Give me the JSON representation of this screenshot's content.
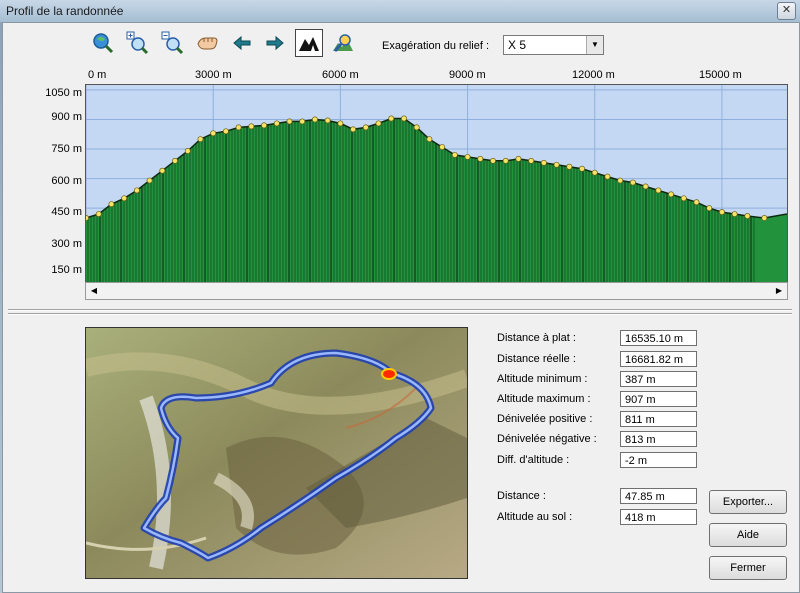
{
  "window": {
    "title": "Profil de la randonnée",
    "close": "✕"
  },
  "toolbar": {
    "exaggeration_label": "Exagération du relief :",
    "exaggeration_value": "X 5",
    "tools": [
      "zoom-all-icon",
      "zoom-in-icon",
      "zoom-out-icon",
      "pan-hand-icon",
      "back-arrow-icon",
      "forward-arrow-icon",
      "terrain-view-icon",
      "profile-zoom-icon"
    ]
  },
  "chart_data": {
    "type": "area",
    "x_ticks": [
      "0 m",
      "3000 m",
      "6000 m",
      "9000 m",
      "12000 m",
      "15000 m"
    ],
    "y_ticks": [
      "1050 m",
      "900 m",
      "750 m",
      "600 m",
      "450 m",
      "300 m",
      "150 m"
    ],
    "xlim": [
      0,
      16535
    ],
    "ylim": [
      75,
      1075
    ],
    "x": [
      0,
      300,
      600,
      900,
      1200,
      1500,
      1800,
      2100,
      2400,
      2700,
      3000,
      3300,
      3600,
      3900,
      4200,
      4500,
      4800,
      5100,
      5400,
      5700,
      6000,
      6300,
      6600,
      6900,
      7200,
      7500,
      7800,
      8100,
      8400,
      8700,
      9000,
      9300,
      9600,
      9900,
      10200,
      10500,
      10800,
      11100,
      11400,
      11700,
      12000,
      12300,
      12600,
      12900,
      13200,
      13500,
      13800,
      14100,
      14400,
      14700,
      15000,
      15300,
      15600,
      16000,
      16535
    ],
    "y": [
      400,
      420,
      470,
      500,
      540,
      590,
      640,
      690,
      740,
      800,
      830,
      840,
      860,
      865,
      870,
      880,
      890,
      890,
      900,
      895,
      880,
      850,
      860,
      880,
      905,
      905,
      860,
      800,
      760,
      720,
      710,
      700,
      690,
      690,
      700,
      690,
      680,
      670,
      660,
      650,
      630,
      610,
      590,
      580,
      560,
      540,
      520,
      500,
      480,
      450,
      430,
      420,
      410,
      400,
      420
    ],
    "fill_color": "#22923d",
    "background_color": "#c4d8f4"
  },
  "stats": [
    {
      "label": "Distance à plat :",
      "value": "16535.10 m"
    },
    {
      "label": "Distance réelle :",
      "value": "16681.82 m"
    },
    {
      "label": "Altitude minimum :",
      "value": "387 m"
    },
    {
      "label": "Altitude maximum :",
      "value": "907 m"
    },
    {
      "label": "Dénivelée positive :",
      "value": "811 m"
    },
    {
      "label": "Dénivelée négative :",
      "value": "813 m"
    },
    {
      "label": "Diff. d'altitude :",
      "value": "-2 m"
    }
  ],
  "cursor": [
    {
      "label": "Distance :",
      "value": "47.85 m"
    },
    {
      "label": "Altitude au sol :",
      "value": "418 m"
    }
  ],
  "buttons": {
    "export": "Exporter...",
    "help": "Aide",
    "close": "Fermer"
  },
  "scroll": {
    "left": "◀",
    "right": "▶"
  }
}
